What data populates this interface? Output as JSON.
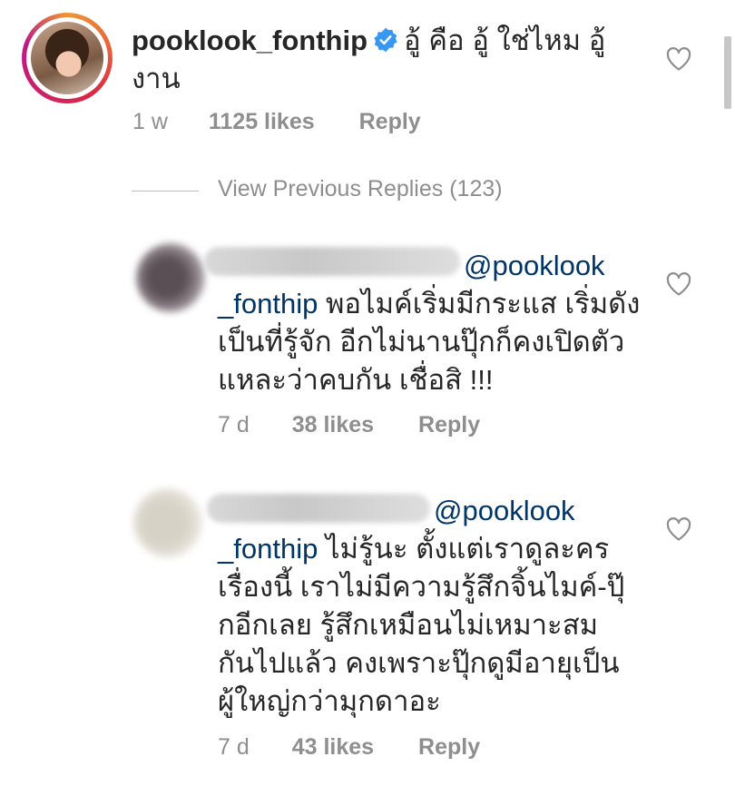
{
  "main_comment": {
    "username": "pooklook_fonthip",
    "text_line1": "อู้ คือ อู้ ใช่ไหม อู้",
    "text_line2": "งาน",
    "time": "1 w",
    "likes": "1125 likes",
    "reply": "Reply"
  },
  "view_previous": "View Previous Replies (123)",
  "replies": [
    {
      "mention_part1": "@pooklook",
      "mention_part2": "_fonthip",
      "line1": "พอไมค์เริ่มมีกระแส เริ่มดัง",
      "line2": "เป็นที่รู้จัก อีกไม่นานปุ๊กก็คงเปิดตัว",
      "line3": "แหละว่าคบกัน เชื่อสิ !!!",
      "time": "7 d",
      "likes": "38 likes",
      "reply": "Reply"
    },
    {
      "mention_part1": "@pooklook",
      "mention_part2": "_fonthip",
      "line1": "ไม่รู้นะ ตั้งแต่เราดูละคร",
      "line2": "เรื่องนี้ เราไม่มีความรู้สึกจิ้นไมค์-ปุ๊",
      "line3": "กอีกเลย รู้สึกเหมือนไม่เหมาะสม",
      "line4": "กันไปแล้ว คงเพราะปุ๊กดูมีอายุเป็น",
      "line5": "ผู้ใหญ่กว่ามุกดาอะ",
      "time": "7 d",
      "likes": "43 likes",
      "reply": "Reply"
    }
  ],
  "colors": {
    "text": "#262626",
    "mention": "#003569",
    "meta": "#8e8e8e",
    "verified": "#3897f0"
  },
  "icons": [
    "verified-badge-icon",
    "heart-icon"
  ]
}
